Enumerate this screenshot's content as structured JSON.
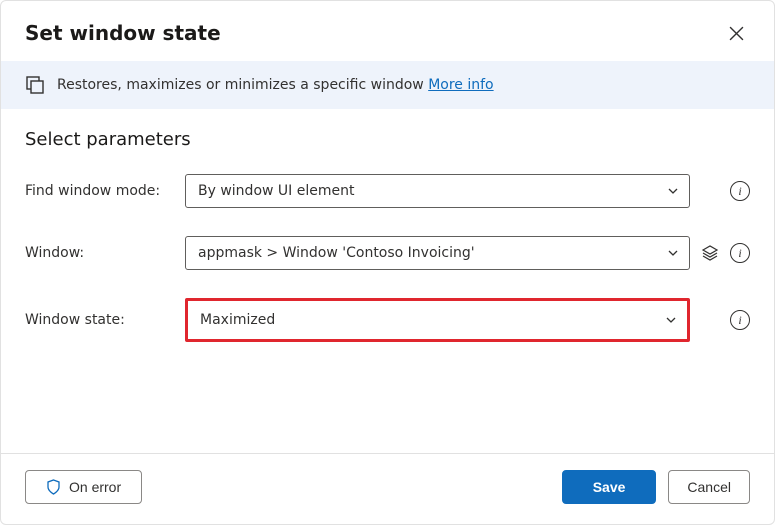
{
  "header": {
    "title": "Set window state"
  },
  "info": {
    "text": "Restores, maximizes or minimizes a specific window",
    "link": "More info"
  },
  "section": {
    "heading": "Select parameters"
  },
  "params": {
    "findWindowMode": {
      "label": "Find window mode:",
      "value": "By window UI element"
    },
    "window": {
      "label": "Window:",
      "value": "appmask > Window 'Contoso Invoicing'"
    },
    "windowState": {
      "label": "Window state:",
      "value": "Maximized"
    }
  },
  "footer": {
    "onError": "On error",
    "save": "Save",
    "cancel": "Cancel"
  }
}
